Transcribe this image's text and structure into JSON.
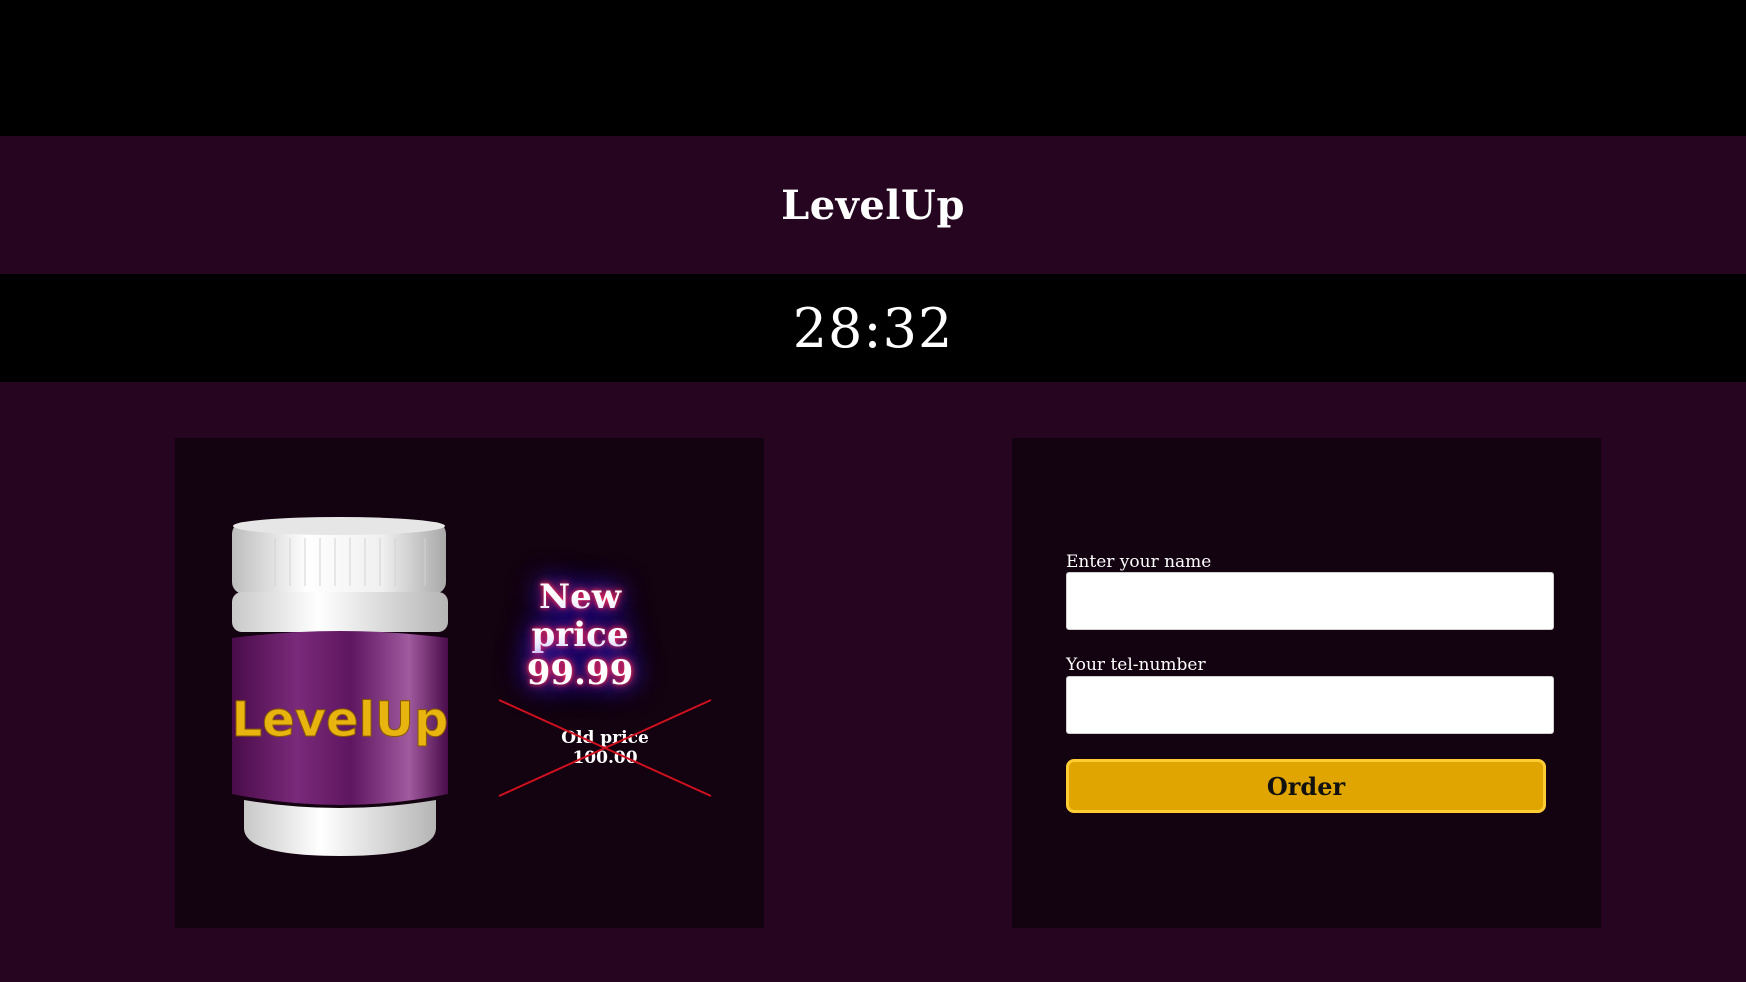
{
  "header": {
    "brand": "LevelUp"
  },
  "timer": {
    "value": "28:32"
  },
  "product": {
    "jar_label": "LevelUp",
    "new_price_label": "New price",
    "new_price_value": "99.99",
    "old_price_label": "Old price",
    "old_price_value": "100.00"
  },
  "form": {
    "name_label": "Enter your name",
    "name_value": "",
    "phone_label": "Your tel-number",
    "phone_value": "",
    "order_button": "Order"
  },
  "colors": {
    "background": "#260520",
    "card": "#13020f",
    "bar": "#000000",
    "button": "#e0a500",
    "button_border": "#ffcc33",
    "strike": "#d0101e",
    "jar_label_bg": "#6a1a6a",
    "jar_text": "#e8b410"
  }
}
